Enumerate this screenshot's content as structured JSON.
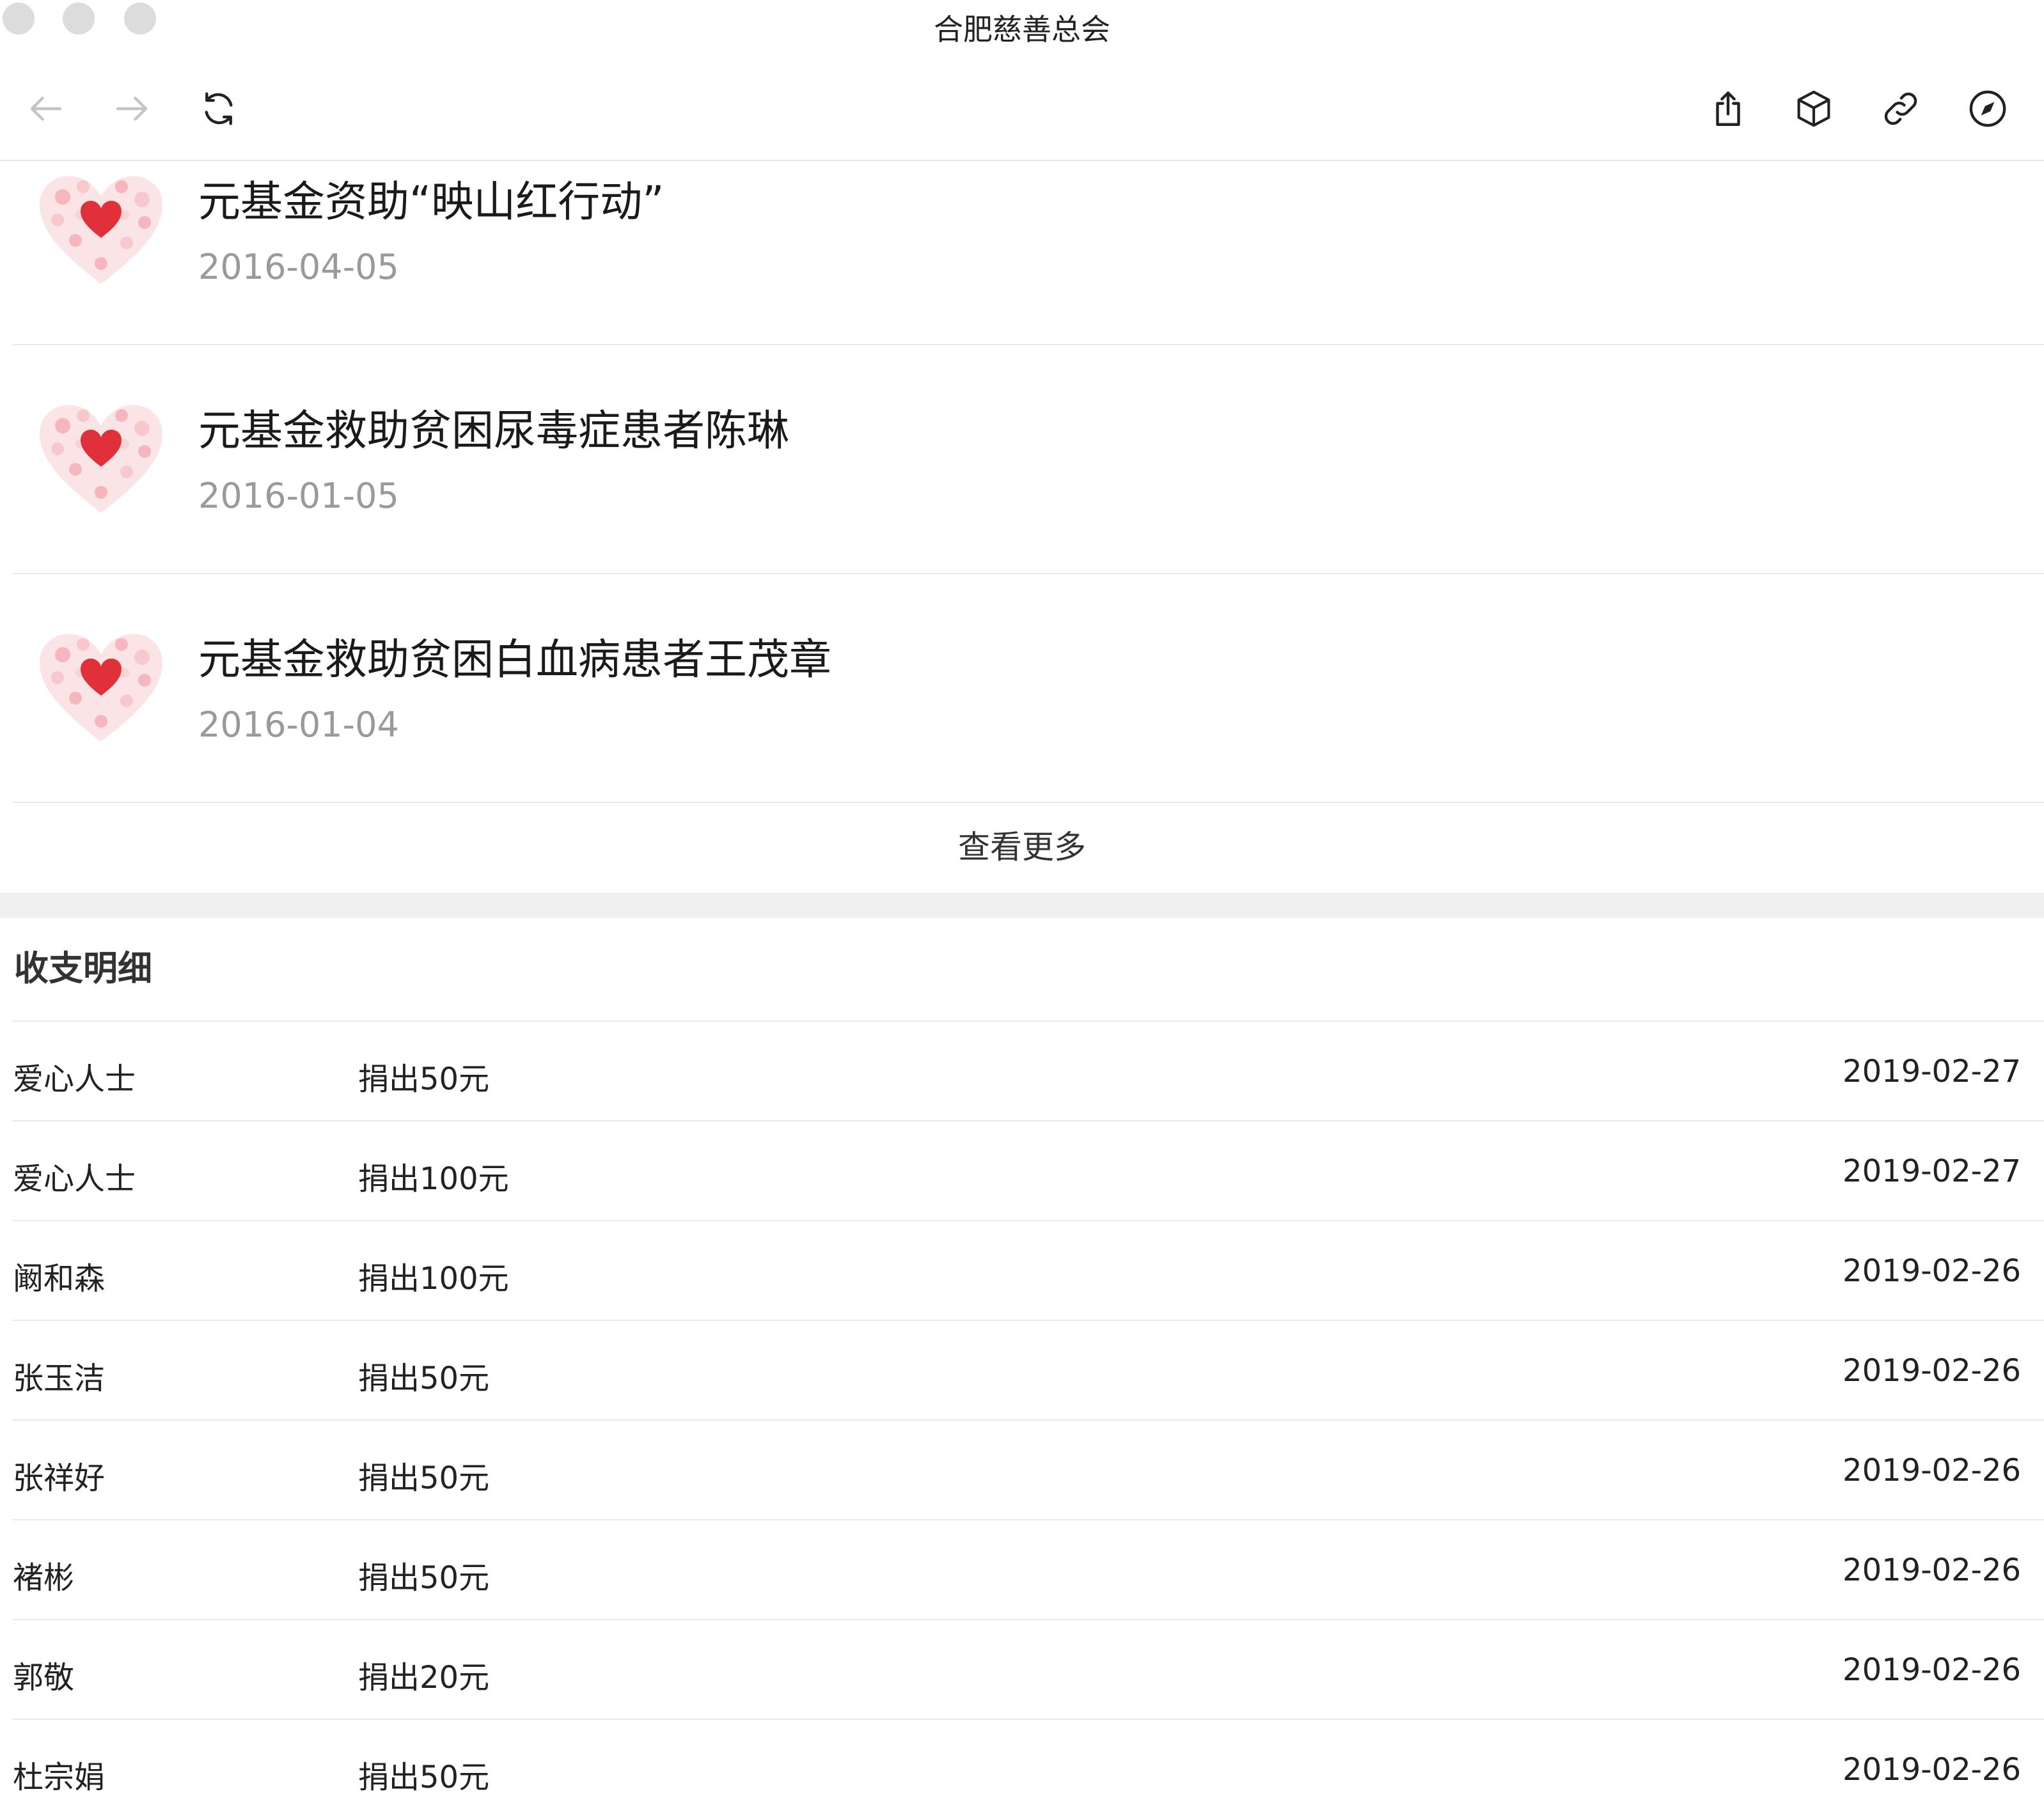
{
  "window": {
    "title": "合肥慈善总会"
  },
  "toolbar": {
    "back_icon": "arrow-left-icon",
    "forward_icon": "arrow-right-icon",
    "reload_icon": "reload-icon",
    "share_icon": "share-icon",
    "box_icon": "cube-icon",
    "link_icon": "link-icon",
    "compass_icon": "compass-icon"
  },
  "news": [
    {
      "title": "元基金资助“映山红行动”",
      "date": "2016-04-05"
    },
    {
      "title": "元基金救助贫困尿毒症患者陈琳",
      "date": "2016-01-05"
    },
    {
      "title": "元基金救助贫困白血病患者王茂章",
      "date": "2016-01-04"
    }
  ],
  "more_label": "查看更多",
  "ledger": {
    "title": "收支明细",
    "rows": [
      {
        "name": "爱心人士",
        "amount": "捐出50元",
        "date": "2019-02-27"
      },
      {
        "name": "爱心人士",
        "amount": "捐出100元",
        "date": "2019-02-27"
      },
      {
        "name": "阚和森",
        "amount": "捐出100元",
        "date": "2019-02-26"
      },
      {
        "name": "张玉洁",
        "amount": "捐出50元",
        "date": "2019-02-26"
      },
      {
        "name": "张祥好",
        "amount": "捐出50元",
        "date": "2019-02-26"
      },
      {
        "name": "褚彬",
        "amount": "捐出50元",
        "date": "2019-02-26"
      },
      {
        "name": "郭敬",
        "amount": "捐出20元",
        "date": "2019-02-26"
      },
      {
        "name": "杜宗娟",
        "amount": "捐出50元",
        "date": "2019-02-26"
      }
    ]
  },
  "colors": {
    "accent": "#e0303a",
    "divider": "#e8e8e8",
    "muted_text": "#9a9a9a",
    "section_bg": "#f0f0f0"
  }
}
